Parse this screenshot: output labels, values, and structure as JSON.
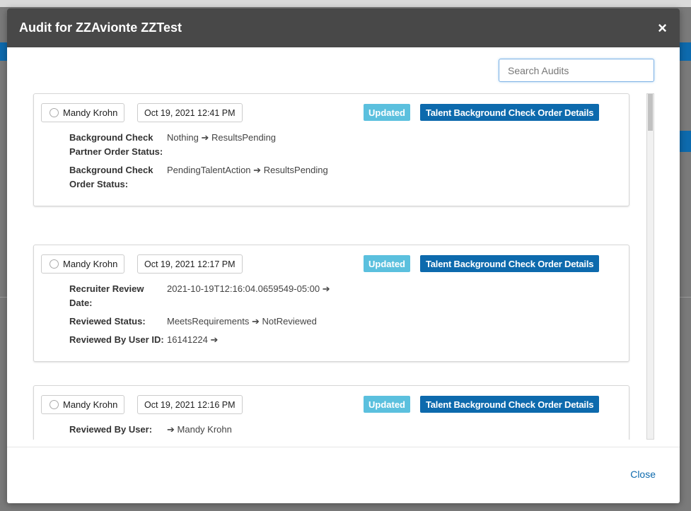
{
  "modal": {
    "title": "Audit for ZZAvionte ZZTest",
    "close_icon": "×",
    "footer_close_label": "Close"
  },
  "search": {
    "placeholder": "Search Audits",
    "value": ""
  },
  "arrow": "➔",
  "audits": [
    {
      "user": "Mandy Krohn",
      "date": "Oct 19, 2021 12:41 PM",
      "action": "Updated",
      "entity": "Talent Background Check Order Details",
      "changes": [
        {
          "field": "Background Check Partner Order Status:",
          "from": "Nothing",
          "to": "ResultsPending"
        },
        {
          "field": "Background Check Order Status:",
          "from": "PendingTalentAction",
          "to": "ResultsPending"
        }
      ]
    },
    {
      "user": "Mandy Krohn",
      "date": "Oct 19, 2021 12:17 PM",
      "action": "Updated",
      "entity": "Talent Background Check Order Details",
      "changes": [
        {
          "field": "Recruiter Review Date:",
          "from": "2021-10-19T12:16:04.0659549-05:00",
          "to": ""
        },
        {
          "field": "Reviewed Status:",
          "from": "MeetsRequirements",
          "to": "NotReviewed"
        },
        {
          "field": "Reviewed By User ID:",
          "from": "16141224",
          "to": ""
        }
      ]
    },
    {
      "user": "Mandy Krohn",
      "date": "Oct 19, 2021 12:16 PM",
      "action": "Updated",
      "entity": "Talent Background Check Order Details",
      "changes": [
        {
          "field": "Reviewed By User:",
          "from": "",
          "to": "Mandy Krohn"
        }
      ]
    }
  ],
  "colors": {
    "header_bg": "#484848",
    "updated_badge": "#5bc0de",
    "entity_badge": "#0d6aad",
    "link": "#0d6aad"
  }
}
